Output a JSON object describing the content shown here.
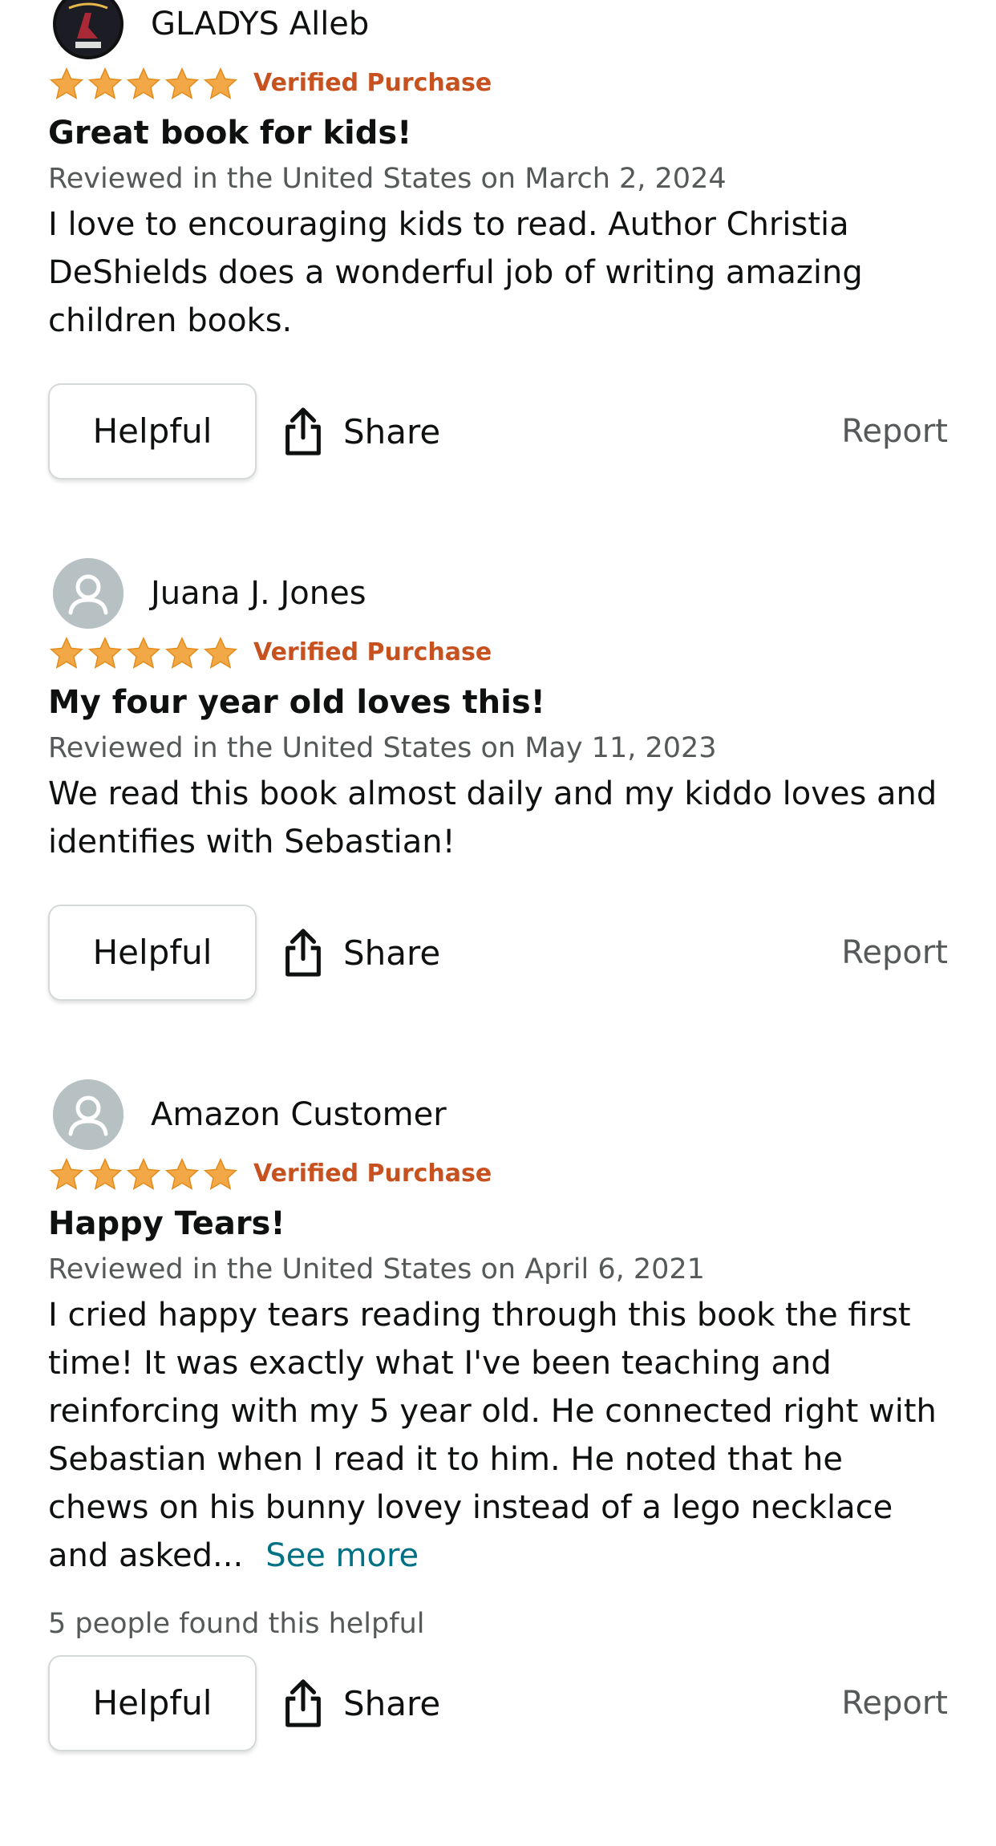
{
  "colors": {
    "star": "#f3a847",
    "verified": "#c7511f",
    "link": "#007185",
    "muted": "#565959"
  },
  "reviews": [
    {
      "reviewer": "GLADYS Alleb",
      "avatar": "profile-photo",
      "rating": 5,
      "verified": "Verified Purchase",
      "title": "Great book for kids!",
      "date": "Reviewed in the United States on March 2, 2024",
      "body": "I love to encouraging kids to read. Author Christia DeShields does a wonderful job of writing amazing children books.",
      "helpful_label": "Helpful",
      "share_label": "Share",
      "report_label": "Report"
    },
    {
      "reviewer": "Juana J. Jones",
      "avatar": "default-avatar",
      "rating": 5,
      "verified": "Verified Purchase",
      "title": "My four year old loves this!",
      "date": "Reviewed in the United States on May 11, 2023",
      "body": "We read this book almost daily and my kiddo loves and identifies with Sebastian!",
      "helpful_label": "Helpful",
      "share_label": "Share",
      "report_label": "Report"
    },
    {
      "reviewer": "Amazon Customer",
      "avatar": "default-avatar",
      "rating": 5,
      "verified": "Verified Purchase",
      "title": "Happy Tears!",
      "date": "Reviewed in the United States on April 6, 2021",
      "body": "I cried happy tears reading through this book the first time! It was exactly what I've been teaching and reinforcing with my 5 year old. He connected right with Sebastian when I read it to him. He noted that he chews on his bunny lovey instead of a lego necklace and asked...",
      "see_more": "See more",
      "helpful_count": "5 people found this helpful",
      "helpful_label": "Helpful",
      "share_label": "Share",
      "report_label": "Report"
    }
  ]
}
